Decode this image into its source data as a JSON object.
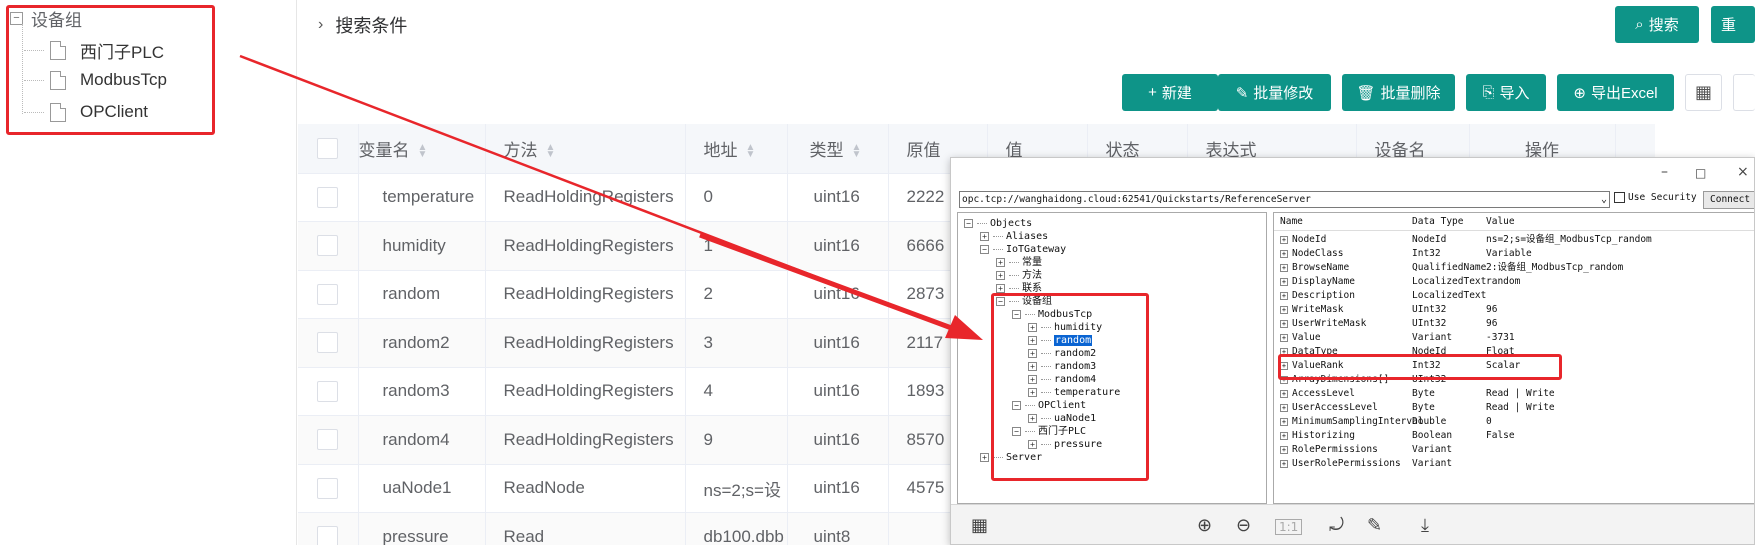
{
  "tree": {
    "root_label": "设备组",
    "toggle": "−",
    "items": [
      "西门子PLC",
      "ModbusTcp",
      "OPClient"
    ]
  },
  "search": {
    "title": "搜索条件",
    "search_label": "搜索",
    "reset_label": "重"
  },
  "toolbar": {
    "new_label": "新建",
    "batch_edit_label": "批量修改",
    "batch_delete_label": "批量删除",
    "import_label": "导入",
    "export_label": "导出Excel"
  },
  "table": {
    "headers": [
      "变量名",
      "方法",
      "地址",
      "类型",
      "原值",
      "值",
      "状态",
      "表达式",
      "设备名",
      "操作"
    ],
    "rows": [
      [
        "temperature",
        "ReadHoldingRegisters",
        "0",
        "uint16",
        "2222"
      ],
      [
        "humidity",
        "ReadHoldingRegisters",
        "1",
        "uint16",
        "6666"
      ],
      [
        "random",
        "ReadHoldingRegisters",
        "2",
        "uint16",
        "2873"
      ],
      [
        "random2",
        "ReadHoldingRegisters",
        "3",
        "uint16",
        "2117"
      ],
      [
        "random3",
        "ReadHoldingRegisters",
        "4",
        "uint16",
        "1893"
      ],
      [
        "random4",
        "ReadHoldingRegisters",
        "9",
        "uint16",
        "8570"
      ],
      [
        "uaNode1",
        "ReadNode",
        "ns=2;s=设",
        "uint16",
        "4575"
      ],
      [
        "pressure",
        "Read",
        "db100.dbb",
        "uint8",
        ""
      ]
    ]
  },
  "opc": {
    "url": "opc.tcp://wanghaidong.cloud:62541/Quickstarts/ReferenceServer",
    "use_security": "Use Security",
    "connect": "Connect",
    "tree": {
      "objects": "Objects",
      "aliases": "Aliases",
      "iotgateway": "IoTGateway",
      "changliang": "常量",
      "fangfa": "方法",
      "lianxi": "联系",
      "shebeizu": "设备组",
      "modbustcp": "ModbusTcp",
      "humidity": "humidity",
      "random": "random",
      "random2": "random2",
      "random3": "random3",
      "random4": "random4",
      "temperature": "temperature",
      "opclient": "OPClient",
      "uanode1": "uaNode1",
      "plc": "西门子PLC",
      "pressure": "pressure",
      "server": "Server"
    },
    "attr_headers": [
      "Name",
      "Data Type",
      "Value"
    ],
    "attrs": [
      [
        "NodeId",
        "NodeId",
        "ns=2;s=设备组_ModbusTcp_random"
      ],
      [
        "NodeClass",
        "Int32",
        "Variable"
      ],
      [
        "BrowseName",
        "QualifiedName",
        "2:设备组_ModbusTcp_random"
      ],
      [
        "DisplayName",
        "LocalizedText",
        "random"
      ],
      [
        "Description",
        "LocalizedText",
        ""
      ],
      [
        "WriteMask",
        "UInt32",
        "96"
      ],
      [
        "UserWriteMask",
        "UInt32",
        "96"
      ],
      [
        "Value",
        "Variant",
        "-3731"
      ],
      [
        "DataType",
        "NodeId",
        "Float"
      ],
      [
        "ValueRank",
        "Int32",
        "Scalar"
      ],
      [
        "ArrayDimensions[]",
        "UInt32",
        ""
      ],
      [
        "AccessLevel",
        "Byte",
        "Read | Write"
      ],
      [
        "UserAccessLevel",
        "Byte",
        "Read | Write"
      ],
      [
        "MinimumSamplingInterval",
        "Double",
        "0"
      ],
      [
        "Historizing",
        "Boolean",
        "False"
      ],
      [
        "RolePermissions",
        "Variant",
        ""
      ],
      [
        "UserRolePermissions",
        "Variant",
        ""
      ]
    ]
  },
  "colors": {
    "accent": "#0e9488",
    "highlight": "#e8262b",
    "selection": "#0a64d2"
  }
}
